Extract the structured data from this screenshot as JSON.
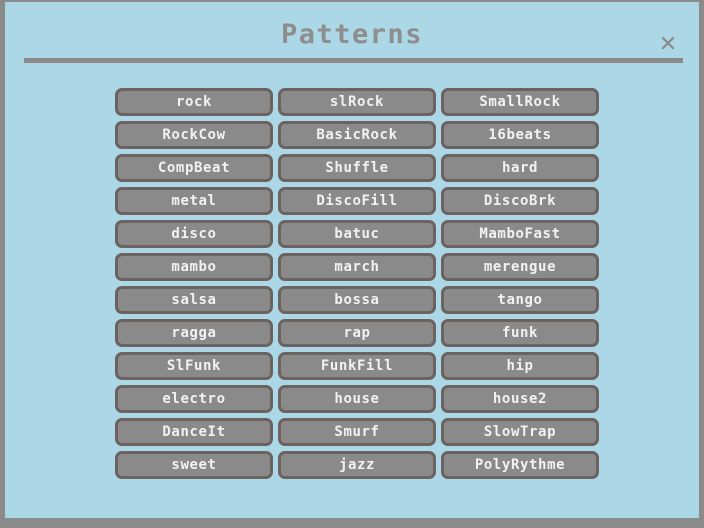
{
  "window": {
    "title": "Patterns",
    "close_label": "✕",
    "background_color": "#abd7e6",
    "frame_color": "#8a8a8a",
    "title_color": "#8e8e8e"
  },
  "grid": {
    "button_fill_color": "#8a8a8a",
    "button_border_color": "#6c6361",
    "button_text_color": "#f2f2f2",
    "columns": 3,
    "rows": [
      [
        "rock",
        "slRock",
        "SmallRock"
      ],
      [
        "RockCow",
        "BasicRock",
        "16beats"
      ],
      [
        "CompBeat",
        "Shuffle",
        "hard"
      ],
      [
        "metal",
        "DiscoFill",
        "DiscoBrk"
      ],
      [
        "disco",
        "batuc",
        "MamboFast"
      ],
      [
        "mambo",
        "march",
        "merengue"
      ],
      [
        "salsa",
        "bossa",
        "tango"
      ],
      [
        "ragga",
        "rap",
        "funk"
      ],
      [
        "SlFunk",
        "FunkFill",
        "hip"
      ],
      [
        "electro",
        "house",
        "house2"
      ],
      [
        "DanceIt",
        "Smurf",
        "SlowTrap"
      ],
      [
        "sweet",
        "jazz",
        "PolyRythme"
      ]
    ]
  }
}
